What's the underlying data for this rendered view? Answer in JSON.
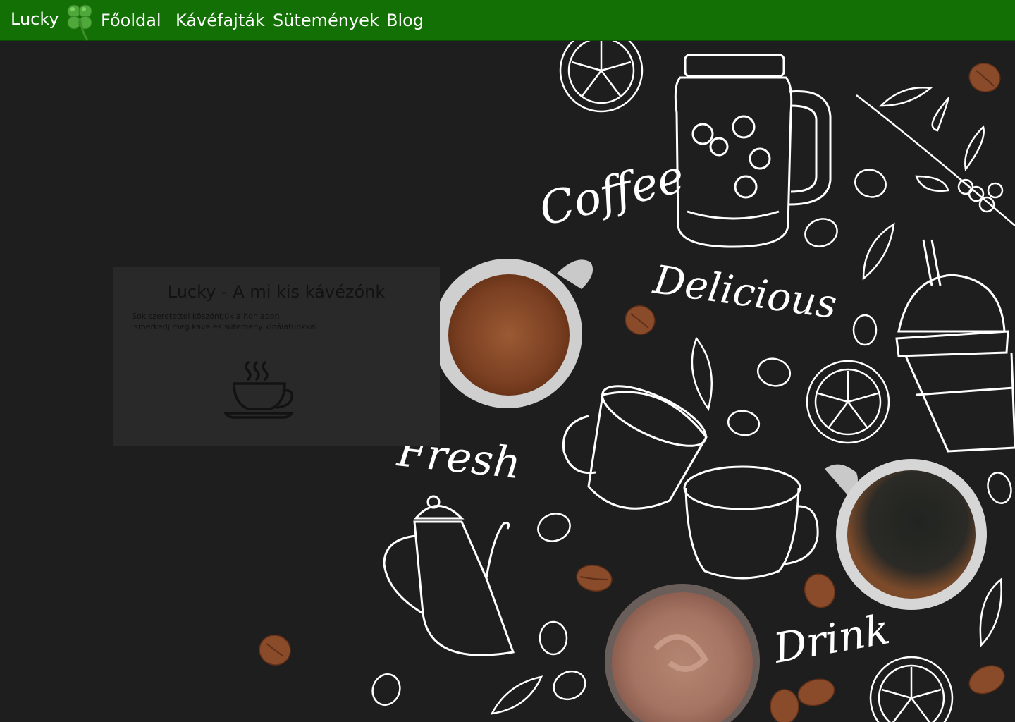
{
  "nav": {
    "brand": "Lucky",
    "links": [
      "Főoldal",
      "Kávéfajták",
      "Sütemények",
      "Blog"
    ]
  },
  "card": {
    "title": "Lucky - A mi kis kávézónk",
    "line1": "Sok szeretettel köszöntjük a honlapon",
    "line2": "Ismerkedj meg kávé és sütemény kínálatunkkal"
  },
  "decor_words": [
    "Coffee",
    "Delicious",
    "Fresh",
    "Drink"
  ],
  "colors": {
    "nav_bg": "#127005",
    "page_bg": "#1f1e1e",
    "card_bg": "#2a2929",
    "chalk": "#ffffff",
    "bean": "#8a4b2a"
  },
  "icons": [
    "clover-icon",
    "coffee-cup-icon"
  ]
}
